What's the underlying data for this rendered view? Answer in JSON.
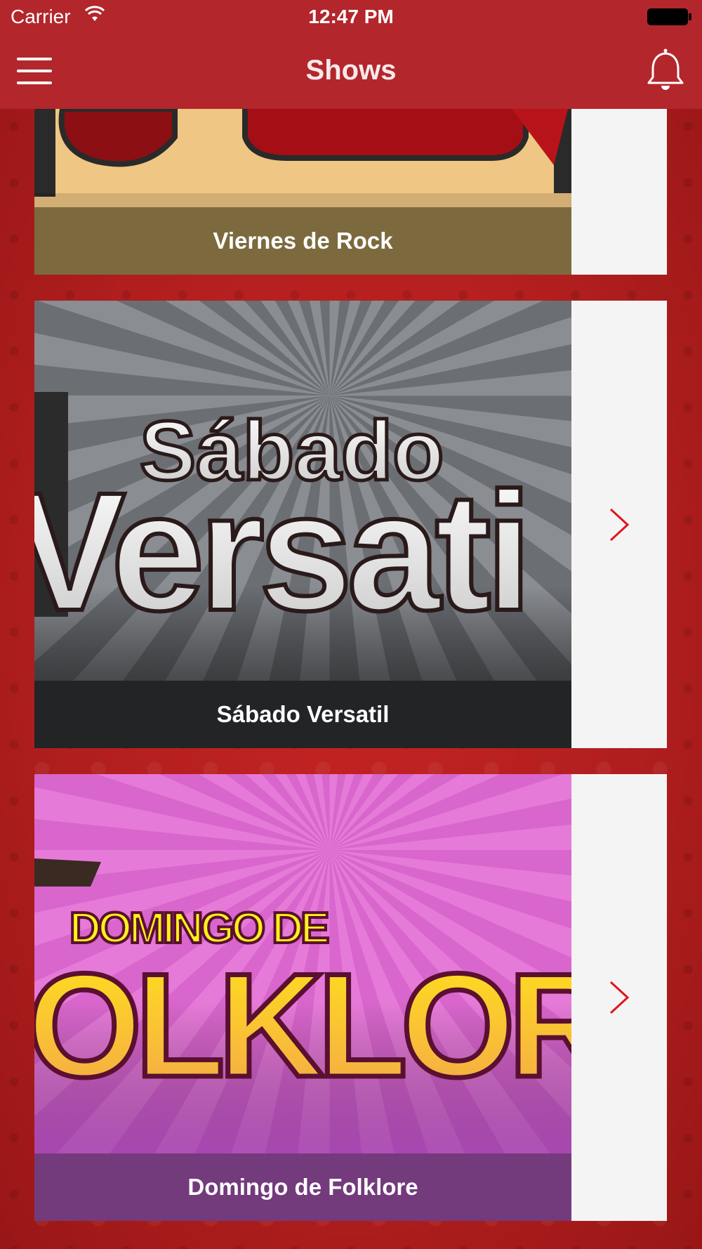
{
  "status_bar": {
    "carrier": "Carrier",
    "time": "12:47 PM"
  },
  "navbar": {
    "title": "Shows",
    "menu_icon": "hamburger-menu-icon",
    "notification_icon": "bell-icon"
  },
  "shows": [
    {
      "title": "Viernes de Rock",
      "art_text": "",
      "caption_color": "#7c6a3e"
    },
    {
      "title": "Sábado Versatil",
      "art_text_top": "Sábado",
      "art_text_main": "Versati",
      "caption_color": "#222426"
    },
    {
      "title": "Domingo de Folklore",
      "art_text_top": "DOMINGO DE",
      "art_text_main": "OLKLOR",
      "caption_color": "#733a7c"
    }
  ],
  "colors": {
    "brand_red": "#b3262b",
    "chevron_red": "#e0161b",
    "side_panel": "#f4f4f4"
  }
}
